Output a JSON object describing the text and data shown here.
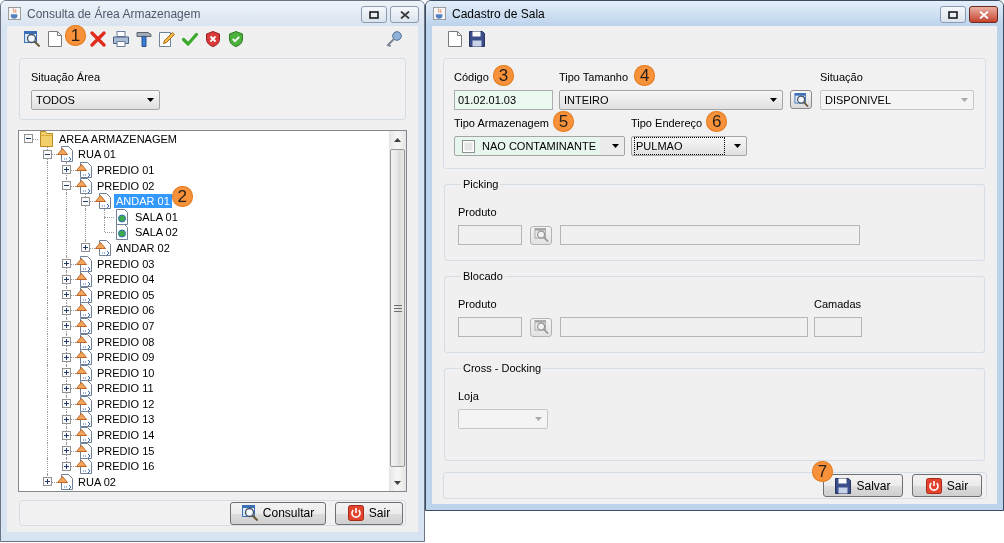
{
  "query_window": {
    "title": "Consulta de Área Armazenagem",
    "active": false,
    "toolbar": {
      "badge": "1"
    },
    "filter": {
      "label": "Situação Área",
      "value": "TODOS"
    },
    "tree": [
      {
        "label": "AREA ARMAZENAGEM",
        "kind": "root",
        "expanded": true,
        "selected": false,
        "children": [
          {
            "label": "RUA 01",
            "kind": "node",
            "expanded": true,
            "selected": false,
            "children": [
              {
                "label": "PREDIO 01",
                "kind": "node",
                "expanded": false,
                "selected": false
              },
              {
                "label": "PREDIO 02",
                "kind": "node",
                "expanded": true,
                "selected": false,
                "children": [
                  {
                    "label": "ANDAR 01",
                    "kind": "node",
                    "expanded": true,
                    "selected": true,
                    "badge": "2",
                    "children": [
                      {
                        "label": "SALA 01",
                        "kind": "leaf",
                        "expanded": false,
                        "selected": false
                      },
                      {
                        "label": "SALA 02",
                        "kind": "leaf",
                        "expanded": false,
                        "selected": false
                      }
                    ]
                  },
                  {
                    "label": "ANDAR 02",
                    "kind": "node",
                    "expanded": false,
                    "selected": false
                  }
                ]
              },
              {
                "label": "PREDIO 03",
                "kind": "node",
                "expanded": false,
                "selected": false
              },
              {
                "label": "PREDIO 04",
                "kind": "node",
                "expanded": false,
                "selected": false
              },
              {
                "label": "PREDIO 05",
                "kind": "node",
                "expanded": false,
                "selected": false
              },
              {
                "label": "PREDIO 06",
                "kind": "node",
                "expanded": false,
                "selected": false
              },
              {
                "label": "PREDIO 07",
                "kind": "node",
                "expanded": false,
                "selected": false
              },
              {
                "label": "PREDIO 08",
                "kind": "node",
                "expanded": false,
                "selected": false
              },
              {
                "label": "PREDIO 09",
                "kind": "node",
                "expanded": false,
                "selected": false
              },
              {
                "label": "PREDIO 10",
                "kind": "node",
                "expanded": false,
                "selected": false
              },
              {
                "label": "PREDIO 11",
                "kind": "node",
                "expanded": false,
                "selected": false
              },
              {
                "label": "PREDIO 12",
                "kind": "node",
                "expanded": false,
                "selected": false
              },
              {
                "label": "PREDIO 13",
                "kind": "node",
                "expanded": false,
                "selected": false
              },
              {
                "label": "PREDIO 14",
                "kind": "node",
                "expanded": false,
                "selected": false
              },
              {
                "label": "PREDIO 15",
                "kind": "node",
                "expanded": false,
                "selected": false
              },
              {
                "label": "PREDIO 16",
                "kind": "node",
                "expanded": false,
                "selected": false
              }
            ]
          },
          {
            "label": "RUA 02",
            "kind": "node",
            "expanded": false,
            "selected": false
          }
        ]
      }
    ],
    "buttons": [
      {
        "label": "Consultar",
        "kind": "search"
      },
      {
        "label": "Sair",
        "kind": "exit"
      }
    ]
  },
  "form_window": {
    "title": "Cadastro de Sala",
    "active": true,
    "fields": {
      "code": {
        "label": "Código",
        "value": "01.02.01.03",
        "badge": "3",
        "highlighted": true
      },
      "size_type": {
        "label": "Tipo Tamanho",
        "value": "INTEIRO",
        "badge": "4"
      },
      "status": {
        "label": "Situação",
        "value": "DISPONIVEL",
        "disabled": true
      },
      "storage_type": {
        "label": "Tipo Armazenagem",
        "value": "NAO CONTAMINANTE",
        "badge": "5",
        "checked": false,
        "highlighted": true
      },
      "address_type": {
        "label": "Tipo Endereço",
        "value": "PULMAO",
        "badge": "6",
        "focused": true
      }
    },
    "picking": {
      "title": "Picking",
      "product": {
        "label": "Produto",
        "disabled": true
      }
    },
    "blocado": {
      "title": "Blocado",
      "product": {
        "label": "Produto",
        "disabled": true
      },
      "layers": {
        "label": "Camadas",
        "disabled": true
      }
    },
    "cross_docking": {
      "title": "Cross - Docking",
      "store": {
        "label": "Loja",
        "disabled": true
      }
    },
    "buttons": [
      {
        "label": "Salvar",
        "kind": "save",
        "badge": "7"
      },
      {
        "label": "Sair",
        "kind": "exit"
      }
    ]
  }
}
